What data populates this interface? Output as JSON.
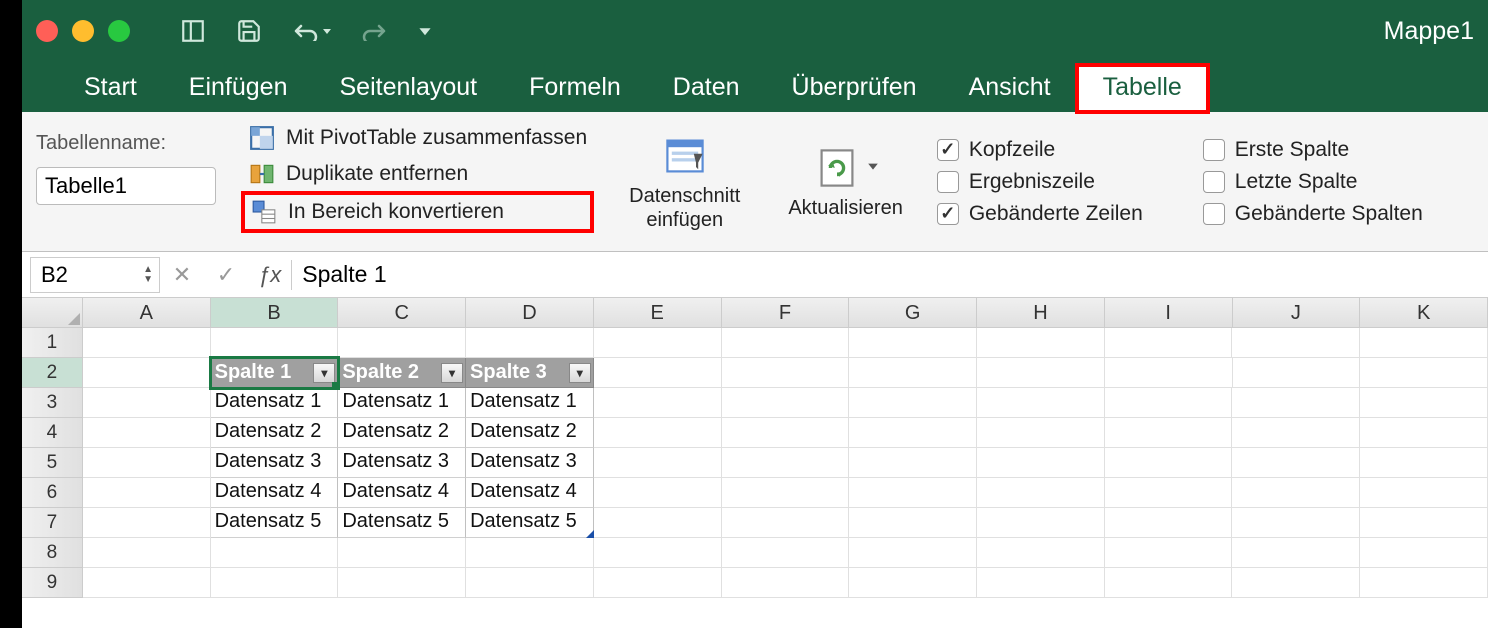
{
  "doc_title": "Mappe1",
  "tabs": [
    "Start",
    "Einfügen",
    "Seitenlayout",
    "Formeln",
    "Daten",
    "Überprüfen",
    "Ansicht",
    "Tabelle"
  ],
  "active_tab": "Tabelle",
  "table_group": {
    "label": "Tabellenname:",
    "value": "Tabelle1"
  },
  "tools": {
    "pivot": "Mit PivotTable zusammenfassen",
    "dedup": "Duplikate entfernen",
    "convert": "In Bereich konvertieren",
    "slicer": "Datenschnitt\neinfügen",
    "refresh": "Aktualisieren"
  },
  "style_options": {
    "header_row": {
      "label": "Kopfzeile",
      "checked": true
    },
    "first_col": {
      "label": "Erste Spalte",
      "checked": false
    },
    "total_row": {
      "label": "Ergebniszeile",
      "checked": false
    },
    "last_col": {
      "label": "Letzte Spalte",
      "checked": false
    },
    "banded_rows": {
      "label": "Gebänderte Zeilen",
      "checked": true
    },
    "banded_cols": {
      "label": "Gebänderte Spalten",
      "checked": false
    }
  },
  "name_box": "B2",
  "formula": "Spalte 1",
  "columns": [
    "A",
    "B",
    "C",
    "D",
    "E",
    "F",
    "G",
    "H",
    "I",
    "J",
    "K"
  ],
  "rows": [
    "1",
    "2",
    "3",
    "4",
    "5",
    "6",
    "7",
    "8",
    "9"
  ],
  "table": {
    "headers": [
      "Spalte 1",
      "Spalte 2",
      "Spalte 3"
    ],
    "data": [
      [
        "Datensatz 1",
        "Datensatz 1",
        "Datensatz 1"
      ],
      [
        "Datensatz 2",
        "Datensatz 2",
        "Datensatz 2"
      ],
      [
        "Datensatz 3",
        "Datensatz 3",
        "Datensatz 3"
      ],
      [
        "Datensatz 4",
        "Datensatz 4",
        "Datensatz 4"
      ],
      [
        "Datensatz 5",
        "Datensatz 5",
        "Datensatz 5"
      ]
    ]
  },
  "selected_cell": "B2"
}
